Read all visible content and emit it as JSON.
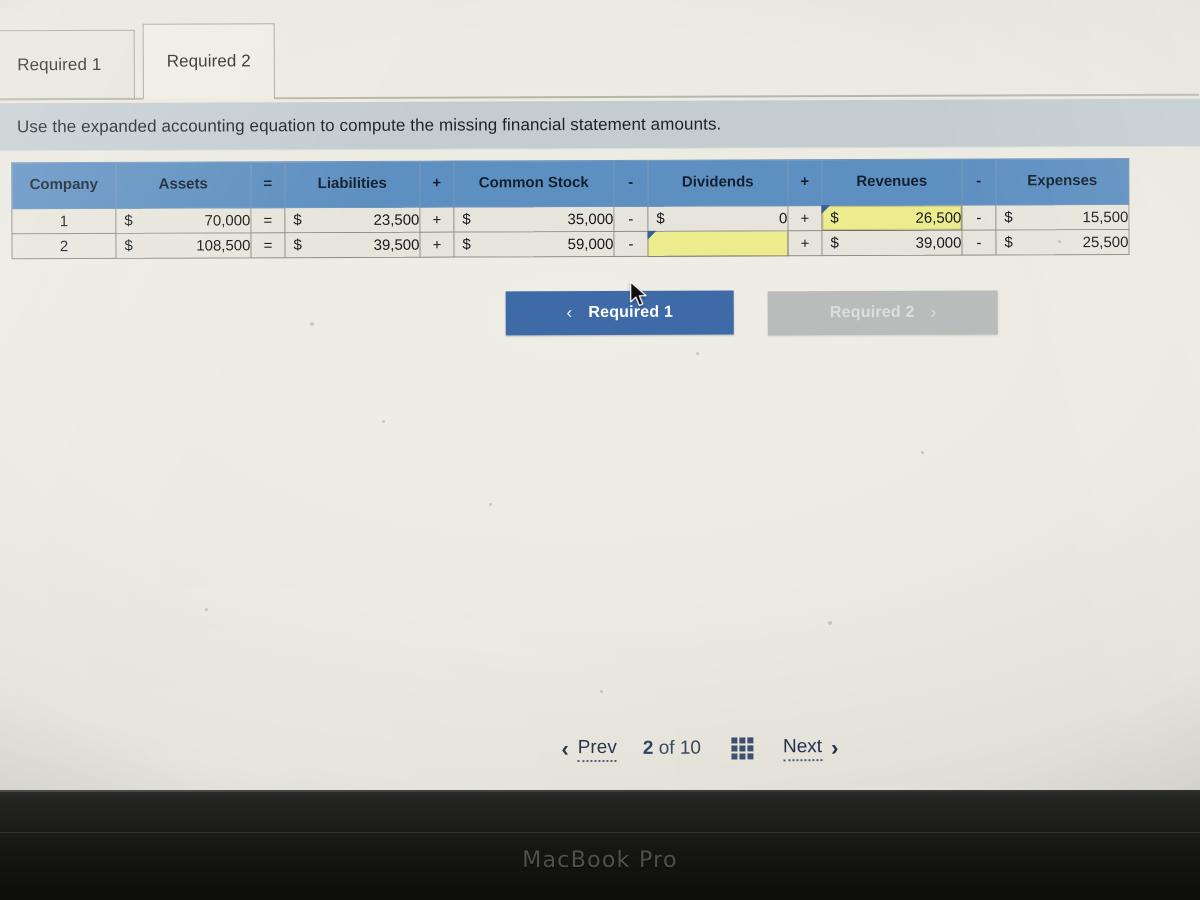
{
  "tabs": [
    {
      "label": "Required 1",
      "active": false
    },
    {
      "label": "Required 2",
      "active": true
    }
  ],
  "instruction": "Use the expanded accounting equation to compute the missing financial statement amounts.",
  "table": {
    "headers": [
      "Company",
      "Assets",
      "=",
      "Liabilities",
      "+",
      "Common Stock",
      "-",
      "Dividends",
      "+",
      "Revenues",
      "-",
      "Expenses"
    ],
    "currency_symbol": "$",
    "rows": [
      {
        "company": "1",
        "assets": "70,000",
        "eq1": "=",
        "liabilities": "23,500",
        "op1": "+",
        "common_stock": "35,000",
        "op2": "-",
        "dividends": "0",
        "op3": "+",
        "revenues": "26,500",
        "op4": "-",
        "expenses": "15,500"
      },
      {
        "company": "2",
        "assets": "108,500",
        "eq1": "=",
        "liabilities": "39,500",
        "op1": "+",
        "common_stock": "59,000",
        "op2": "-",
        "dividends": "",
        "op3": "+",
        "revenues": "39,000",
        "op4": "-",
        "expenses": "25,500"
      }
    ]
  },
  "nav": {
    "prev_chevron": "‹",
    "prev_label": "Required 1",
    "next_label": "Required 2",
    "next_chevron": "›"
  },
  "pager": {
    "prev_chevron": "‹",
    "prev_label": "Prev",
    "current": "2",
    "of": "of",
    "total": "10",
    "next_label": "Next",
    "next_chevron": "›"
  },
  "device": {
    "brand_label": "MacBook Pro"
  },
  "colors": {
    "header_blue": "#5d8fc0",
    "banner_blue_gray": "#c3cdd0",
    "highlight_yellow": "#ecec8e",
    "primary_button": "#3e6aa8",
    "disabled_button": "#b9bcbb"
  },
  "chart_data": {
    "type": "table",
    "title": "Expanded accounting equation worksheet",
    "columns": [
      "Company",
      "Assets",
      "=",
      "Liabilities",
      "+",
      "Common Stock",
      "-",
      "Dividends",
      "+",
      "Revenues",
      "-",
      "Expenses"
    ],
    "rows": [
      [
        "1",
        70000,
        "=",
        23500,
        "+",
        35000,
        "-",
        0,
        "+",
        26500,
        "-",
        15500
      ],
      [
        "2",
        108500,
        "=",
        39500,
        "+",
        59000,
        "-",
        null,
        "+",
        39000,
        "-",
        25500
      ]
    ],
    "editable_cells": [
      {
        "row": 1,
        "column": "Revenues",
        "value": 26500,
        "state": "filled"
      },
      {
        "row": 2,
        "column": "Dividends",
        "value": null,
        "state": "empty"
      }
    ]
  }
}
